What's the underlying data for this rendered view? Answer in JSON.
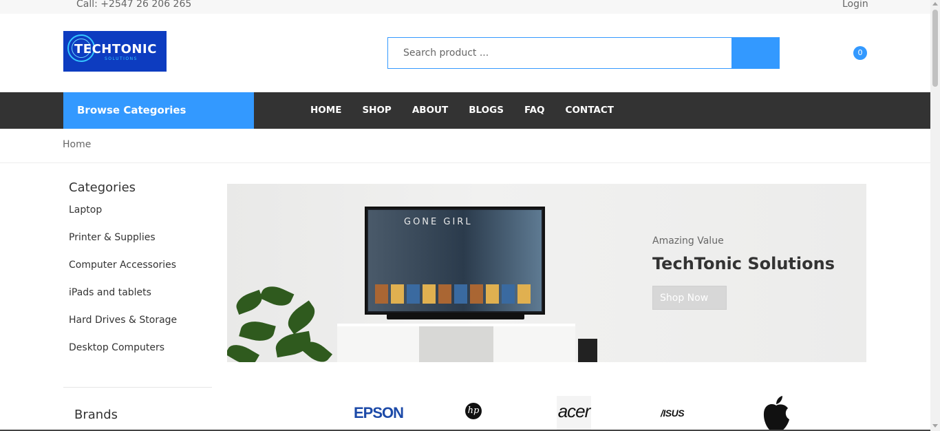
{
  "topbar": {
    "call": "Call: +2547 26 206 265",
    "login": "Login"
  },
  "header": {
    "logo_text": "TECHTONIC",
    "logo_subtext": "SOLUTIONS",
    "search_placeholder": "Search product ...",
    "cart_count": "0"
  },
  "nav": {
    "browse_label": "Browse Categories",
    "items": [
      "HOME",
      "SHOP",
      "ABOUT",
      "BLOGS",
      "FAQ",
      "CONTACT"
    ]
  },
  "breadcrumb": {
    "current": "Home"
  },
  "sidebar": {
    "categories_title": "Categories",
    "categories": [
      "Laptop",
      "Printer & Supplies",
      "Computer Accessories",
      "iPads and tablets",
      "Hard Drives & Storage",
      "Desktop Computers"
    ],
    "brands_title": "Brands"
  },
  "banner": {
    "kicker": "Amazing Value",
    "headline": "TechTonic Solutions",
    "cta": "Shop Now",
    "tv_title": "GONE GIRL"
  },
  "brands": {
    "epson": "EPSON",
    "hp": "hp",
    "acer": "acer",
    "asus": "/ISUS"
  },
  "colors": {
    "accent": "#3399ff",
    "nav_bg": "#333333",
    "logo_bg": "#0d3cc0"
  }
}
